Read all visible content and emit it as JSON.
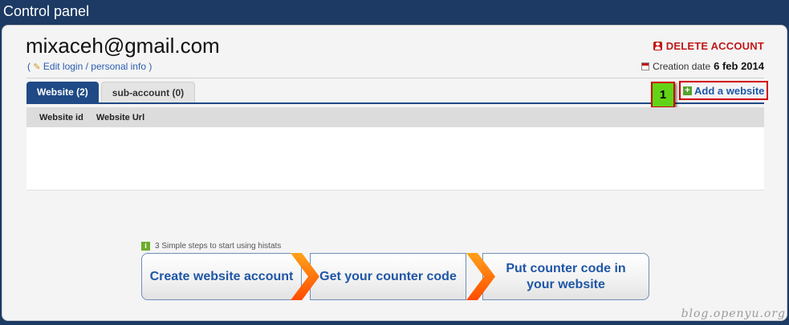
{
  "window": {
    "title": "Control panel"
  },
  "account": {
    "email": "mixaceh@gmail.com",
    "edit_open": "(",
    "edit_label": "Edit login / personal info",
    "edit_close": ")",
    "delete_label": "DELETE ACCOUNT",
    "creation_label": "Creation date",
    "creation_value": "6 feb 2014"
  },
  "tabs": [
    {
      "label": "Website (2)",
      "active": true
    },
    {
      "label": "sub-account (0)",
      "active": false
    }
  ],
  "toolbar": {
    "add_website_label": "Add a website",
    "step_badge": "1"
  },
  "table": {
    "columns": [
      "Website id",
      "Website Url"
    ],
    "rows": []
  },
  "steps": {
    "caption": "3 Simple steps to start using histats",
    "items": [
      "Create website account",
      "Get your counter code",
      "Put counter code in your website"
    ]
  },
  "watermark": "blog.openyu.org",
  "colors": {
    "header_bg": "#1c3a63",
    "accent": "#1f4a86",
    "danger": "#c01818",
    "badge": "#62d418"
  }
}
